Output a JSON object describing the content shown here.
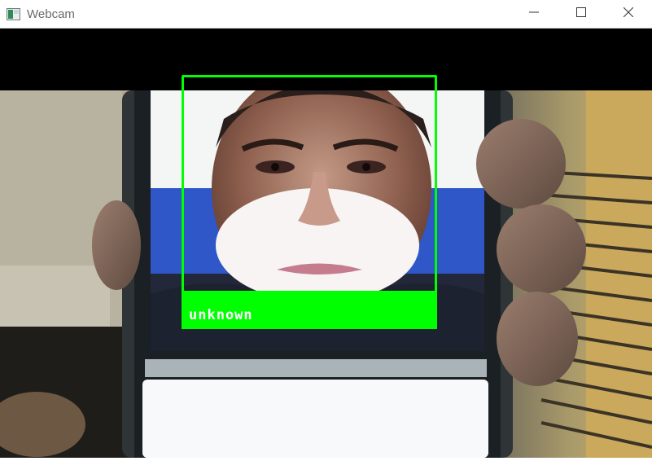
{
  "window": {
    "title": "Webcam",
    "icon": "webcam-app-icon",
    "controls": {
      "minimize_icon": "minimize-icon",
      "maximize_icon": "maximize-icon",
      "close_icon": "close-icon"
    }
  },
  "detection": {
    "label": "unknown",
    "box_color": "#00ff00",
    "label_text_color": "#ffffff"
  }
}
